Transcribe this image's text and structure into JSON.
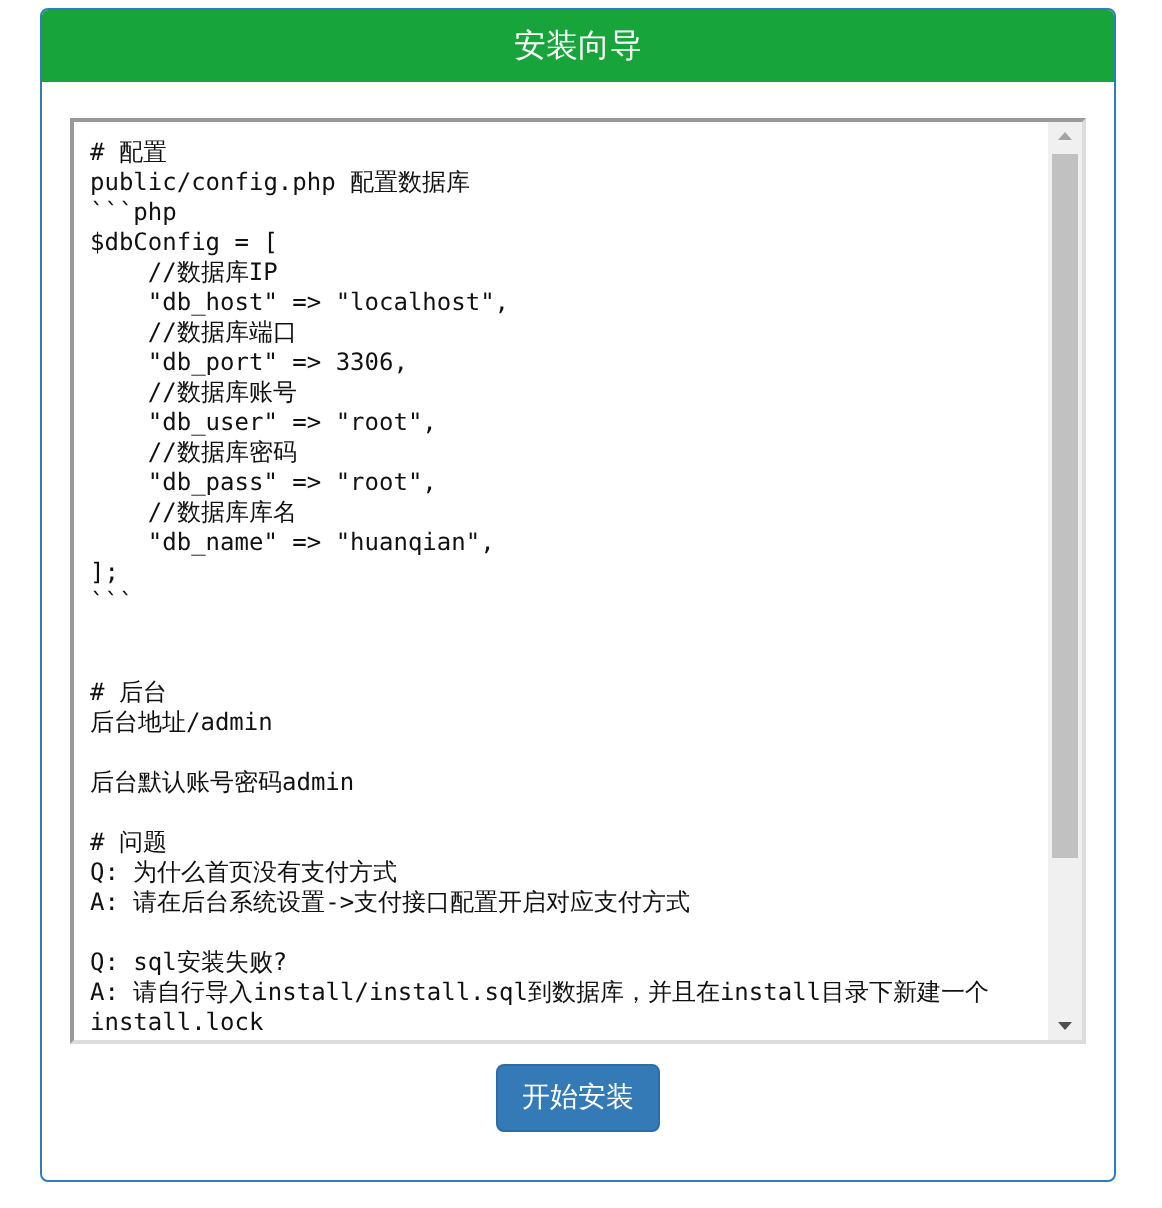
{
  "panel": {
    "title": "安装向导"
  },
  "readme": {
    "blocks": [
      {
        "lines": [
          "# 配置",
          "public/config.php 配置数据库",
          "```php",
          "$dbConfig = [",
          "    //数据库IP",
          "    \"db_host\" => \"localhost\",",
          "    //数据库端口",
          "    \"db_port\" => 3306,",
          "    //数据库账号",
          "    \"db_user\" => \"root\",",
          "    //数据库密码",
          "    \"db_pass\" => \"root\",",
          "    //数据库库名",
          "    \"db_name\" => \"huanqian\",",
          "];",
          "```"
        ]
      },
      {
        "lines": [
          "# 后台",
          "后台地址/admin"
        ]
      },
      {
        "lines": [
          "后台默认账号密码admin"
        ]
      },
      {
        "lines": [
          "# 问题",
          "Q: 为什么首页没有支付方式",
          "A: 请在后台系统设置->支付接口配置开启对应支付方式"
        ]
      },
      {
        "lines": [
          "Q: sql安装失败?",
          "A: 请自行导入install/install.sql到数据库，并且在install目录下新建一个install.lock"
        ]
      }
    ]
  },
  "install_button": {
    "label": "开始安装"
  }
}
